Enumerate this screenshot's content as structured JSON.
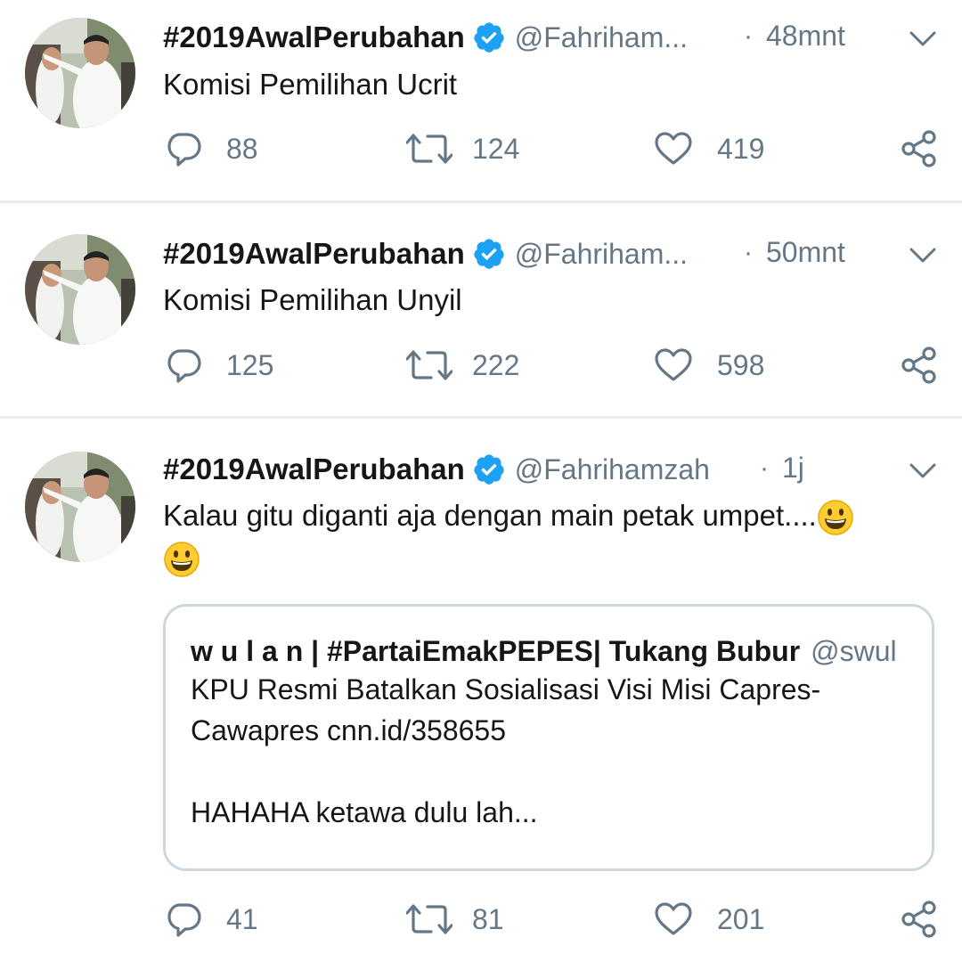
{
  "tweets": [
    {
      "display_name": "#2019AwalPerubahan",
      "handle": "@Fahriham...",
      "separator": "·",
      "time": "48mnt",
      "text": "Komisi Pemilihan Ucrit",
      "replies": "88",
      "retweets": "124",
      "likes": "419"
    },
    {
      "display_name": "#2019AwalPerubahan",
      "handle": "@Fahriham...",
      "separator": "·",
      "time": "50mnt",
      "text": "Komisi Pemilihan Unyil",
      "replies": "125",
      "retweets": "222",
      "likes": "598"
    },
    {
      "display_name": "#2019AwalPerubahan",
      "handle": "@Fahrihamzah",
      "separator": "·",
      "time": "1j",
      "text": "Kalau gitu diganti aja dengan main petak umpet....",
      "replies": "41",
      "retweets": "81",
      "likes": "201",
      "quote": {
        "display_name": "w u l a n | #PartaiEmakPEPES| Tukang Bubur",
        "handle": "@swul",
        "text": "KPU Resmi Batalkan Sosialisasi Visi Misi Capres-\nCawapres cnn.id/358655\n\nHAHAHA ketawa dulu lah..."
      }
    }
  ],
  "colors": {
    "verified": "#1da1f2",
    "muted": "#657786",
    "divider": "#e6ecf0",
    "quote_border": "#ccd6dd"
  },
  "icons": [
    "verified-badge-icon",
    "chevron-down-icon",
    "reply-icon",
    "retweet-icon",
    "like-icon",
    "share-icon",
    "grinning-emoji-icon"
  ]
}
